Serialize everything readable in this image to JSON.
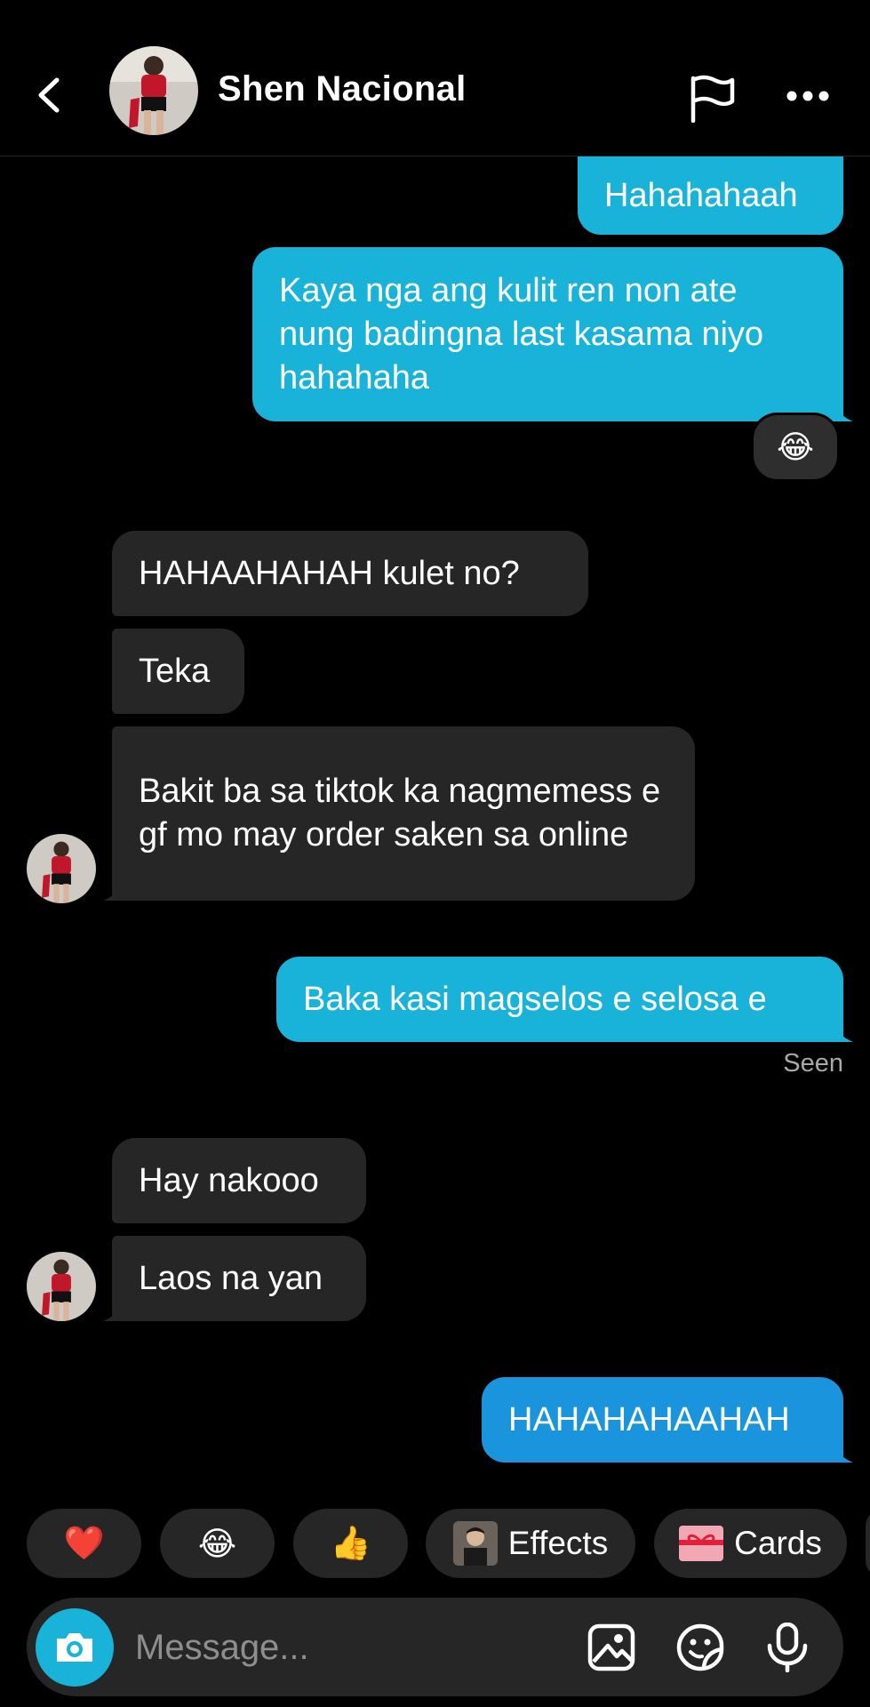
{
  "header": {
    "contact_name": "Shen Nacional",
    "back_icon": "chevron-left-icon",
    "flag_icon": "flag-icon",
    "more_icon": "more-horizontal-icon"
  },
  "messages": [
    {
      "dir": "out",
      "text": "Hahahahaah"
    },
    {
      "dir": "out",
      "text": "Kaya nga ang kulit ren non ate nung badingna last kasama niyo hahahaha",
      "reaction": "😂"
    },
    {
      "dir": "in",
      "text": "HAHAAHAHAH kulet no?"
    },
    {
      "dir": "in",
      "text": "Teka"
    },
    {
      "dir": "in",
      "text": "Bakit ba sa tiktok ka nagmemess e gf mo may order saken sa online"
    },
    {
      "dir": "out",
      "text": "Baka kasi magselos e selosa e"
    },
    {
      "dir": "in",
      "text": "Hay nakooo"
    },
    {
      "dir": "in",
      "text": "Laos na yan"
    },
    {
      "dir": "out",
      "text": "HAHAHAHAAHAH"
    }
  ],
  "status": {
    "seen": "Seen"
  },
  "quick_actions": [
    {
      "icon": "heart-icon",
      "label": "❤️"
    },
    {
      "icon": "laugh-emoji-icon",
      "label": "😂"
    },
    {
      "icon": "thumbs-up-icon",
      "label": "👍"
    },
    {
      "icon": "effects-thumbnail-icon",
      "label": "Effects"
    },
    {
      "icon": "gift-card-icon",
      "label": "Cards"
    }
  ],
  "composer": {
    "placeholder": "Message...",
    "camera_icon": "camera-icon",
    "gallery_icon": "image-icon",
    "sticker_icon": "sticker-icon",
    "mic_icon": "microphone-icon"
  },
  "colors": {
    "background": "#000000",
    "outgoing_bubble": "#19b3d9",
    "incoming_bubble": "#262626",
    "last_outgoing_bubble": "#1a95dd"
  }
}
